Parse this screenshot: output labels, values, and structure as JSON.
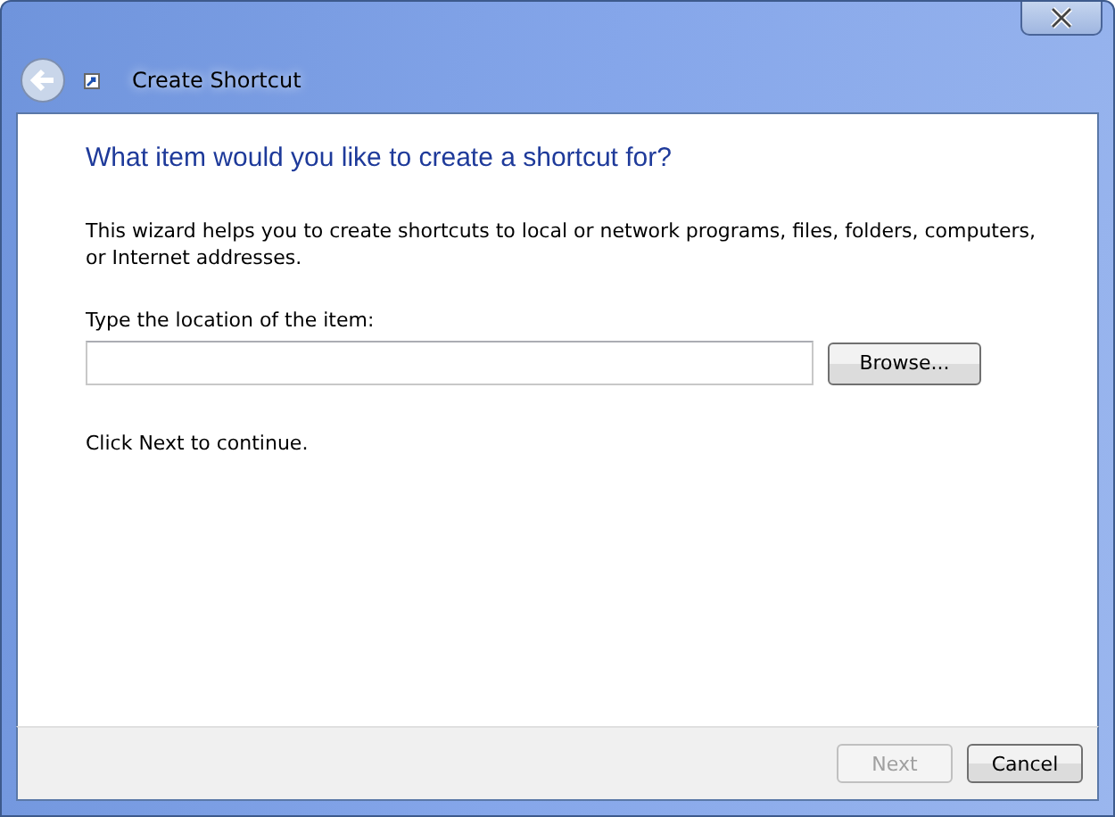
{
  "window": {
    "title": "Create Shortcut"
  },
  "heading": "What item would you like to create a shortcut for?",
  "description": "This wizard helps you to create shortcuts to local or network programs, files, folders, computers, or Internet addresses.",
  "location": {
    "label": "Type the location of the item:",
    "browse": "Browse..."
  },
  "hint": "Click Next to continue.",
  "buttons": [
    {
      "label": "Next",
      "disabled": true
    },
    {
      "label": "Cancel",
      "disabled": false
    }
  ]
}
